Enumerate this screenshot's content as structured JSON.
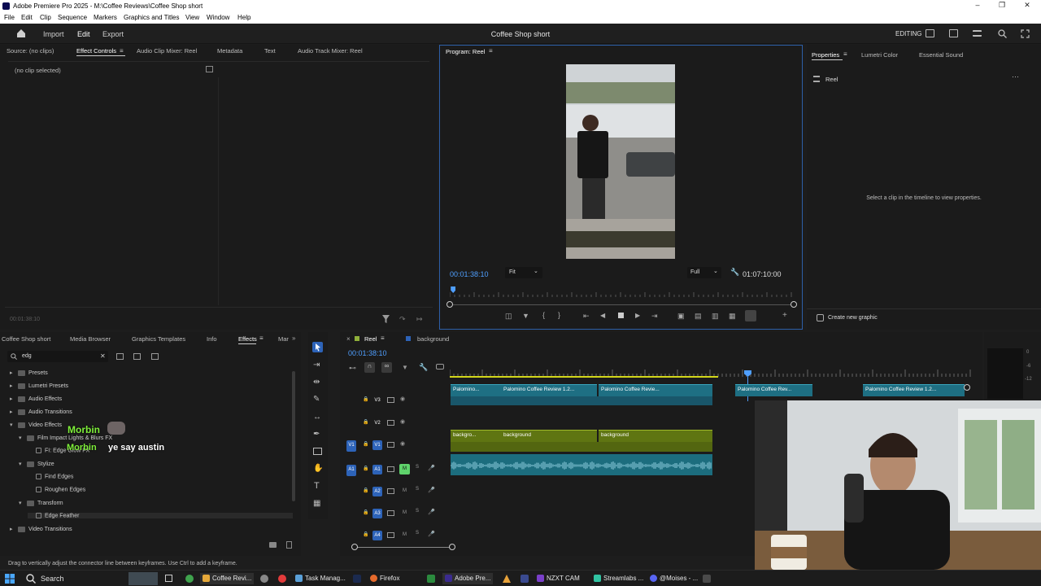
{
  "window": {
    "title": "Adobe Premiere Pro 2025 - M:\\Coffee Reviews\\Coffee Shop short"
  },
  "menu": [
    "File",
    "Edit",
    "Clip",
    "Sequence",
    "Markers",
    "Graphics and Titles",
    "View",
    "Window",
    "Help"
  ],
  "header": {
    "nav": [
      "Import",
      "Edit",
      "Export"
    ],
    "active_nav": "Edit",
    "project_title": "Coffee Shop short",
    "workspace": "EDITING"
  },
  "source_panel": {
    "tabs": [
      "Source: (no clips)",
      "Effect Controls",
      "Audio Clip Mixer: Reel",
      "Metadata",
      "Text",
      "Audio Track Mixer: Reel"
    ],
    "no_clip": "(no clip selected)",
    "timecode": "00:01:38:10"
  },
  "program": {
    "tab": "Program: Reel",
    "timecode": "00:01:38:10",
    "fit": "Fit",
    "quality": "Full",
    "duration": "01:07:10:00",
    "playhead_fraction": 0.01
  },
  "properties": {
    "tabs": [
      "Properties",
      "Lumetri Color",
      "Essential Sound"
    ],
    "sequence_name": "Reel",
    "hint": "Select a clip in the timeline to view properties.",
    "create_graphic": "Create new graphic"
  },
  "project_panel": {
    "tabs": [
      "Coffee Shop short",
      "Media Browser",
      "Graphics Templates",
      "Info",
      "Effects",
      "Mar"
    ],
    "search_value": "edg",
    "tree": [
      {
        "label": "Presets",
        "depth": 0
      },
      {
        "label": "Lumetri Presets",
        "depth": 0
      },
      {
        "label": "Audio Effects",
        "depth": 0
      },
      {
        "label": "Audio Transitions",
        "depth": 0
      },
      {
        "label": "Video Effects",
        "depth": 0
      },
      {
        "label": "Film Impact Lights & Blurs FX",
        "depth": 1
      },
      {
        "label": "FI: Edge Glow FX",
        "depth": 2
      },
      {
        "label": "Stylize",
        "depth": 1
      },
      {
        "label": "Find Edges",
        "depth": 2
      },
      {
        "label": "Roughen Edges",
        "depth": 2
      },
      {
        "label": "Transform",
        "depth": 1
      },
      {
        "label": "Edge Feather",
        "depth": 2
      },
      {
        "label": "Video Transitions",
        "depth": 0
      }
    ],
    "overlay_text_1": "Morbin",
    "overlay_text_2": "Morbin",
    "overlay_text_3": "ye say austin"
  },
  "timeline": {
    "tabs": [
      "Reel",
      "background"
    ],
    "timecode": "00:01:38:10",
    "tracks_video": [
      "V3",
      "V2",
      "V1"
    ],
    "tracks_audio": [
      "A1",
      "A2",
      "A3",
      "A4"
    ],
    "clips_v3": [
      "Palomino...",
      "Palomino Coffee Review 1.2...",
      "Palomino Coffee Revie...",
      "Palomino Coffee Rev...",
      "Palomino Coffee Review 1.2..."
    ],
    "clips_v1": [
      "backgro...",
      "background",
      "background"
    ],
    "mute_label": "M",
    "solo_label": "S",
    "meter_labels": [
      "0",
      "-6",
      "-12"
    ]
  },
  "status_bar": {
    "text": "Drag to vertically adjust the connector line between keyframes. Use Ctrl to add a keyframe."
  },
  "taskbar": {
    "search": "Search",
    "apps": [
      "Coffee Revi...",
      "Task Manag...",
      "Firefox",
      "Adobe Pre...",
      "NZXT CAM",
      "Streamlabs ...",
      "@Moises - ..."
    ]
  },
  "colors": {
    "accent_blue": "#2d63b8",
    "v_clip": "#5f7512",
    "a_clip": "#1c6d7e",
    "timecode_blue": "#4f9fff"
  }
}
